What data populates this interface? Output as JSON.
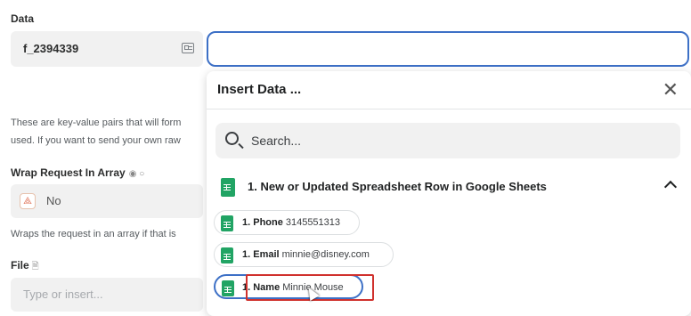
{
  "form": {
    "data_label": "Data",
    "data_key_value": "f_2394339",
    "description_line1": "These are key-value pairs that will form",
    "description_line2": "used. If you want to send your own raw",
    "wrap_label": "Wrap Request In Array",
    "wrap_radios": "◉ ○",
    "wrap_value": "No",
    "wrap_help": "Wraps the request in an array if that is",
    "file_label": "File",
    "file_placeholder": "Type or insert..."
  },
  "dropdown": {
    "title": "Insert Data ...",
    "search_placeholder": "Search...",
    "section_title": "1. New or Updated Spreadsheet Row in Google Sheets",
    "items": [
      {
        "key": "1. Phone",
        "value": "3145551313"
      },
      {
        "key": "1. Email",
        "value": "minnie@disney.com"
      },
      {
        "key": "1. Name",
        "value": "Minnie Mouse"
      }
    ]
  },
  "colors": {
    "accent_blue": "#3d70c6",
    "sheets_green": "#21a464",
    "highlight_red": "#d0312d"
  },
  "icons": [
    "list-icon",
    "webhook-icon",
    "file-icon",
    "close-icon",
    "search-icon",
    "google-sheets-icon",
    "chevron-up-icon"
  ]
}
